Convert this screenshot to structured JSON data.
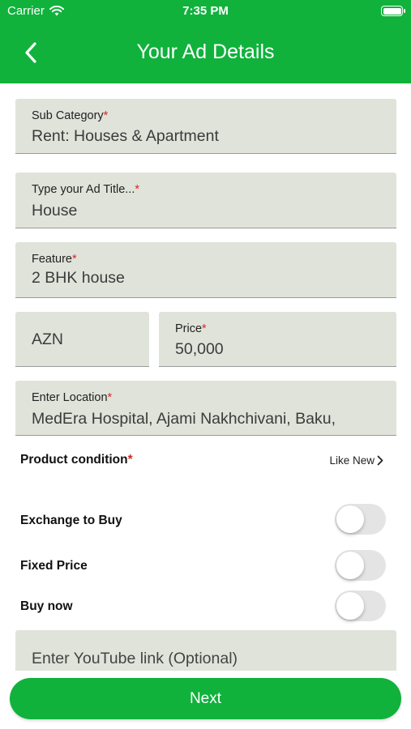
{
  "status": {
    "carrier": "Carrier",
    "time": "7:35 PM"
  },
  "header": {
    "title": "Your Ad Details",
    "back_icon": "chevron-left-icon"
  },
  "form": {
    "sub_category": {
      "label": "Sub Category",
      "required_mark": "*",
      "value": "Rent: Houses & Apartment"
    },
    "ad_title": {
      "label": "Type your Ad Title...",
      "required_mark": "*",
      "value": "House"
    },
    "feature": {
      "label": "Feature",
      "required_mark": "*",
      "value": "2 BHK house"
    },
    "currency": {
      "value": "AZN"
    },
    "price": {
      "label": "Price",
      "required_mark": "*",
      "value": "50,000"
    },
    "location": {
      "label": "Enter Location",
      "required_mark": "*",
      "value": "MedEra Hospital, Ajami Nakhchivani, Baku,"
    },
    "product_condition": {
      "label": "Product condition",
      "required_mark": "*",
      "value": "Like New"
    },
    "toggles": [
      {
        "label": "Exchange to Buy",
        "on": false
      },
      {
        "label": "Fixed Price",
        "on": false
      },
      {
        "label": "Buy now",
        "on": false
      }
    ],
    "youtube": {
      "placeholder": "Enter YouTube link (Optional)"
    }
  },
  "next_button": {
    "label": "Next"
  },
  "colors": {
    "brand_green": "#10b23c",
    "field_bg": "#e0e3da",
    "required_red": "#d22a2a"
  }
}
